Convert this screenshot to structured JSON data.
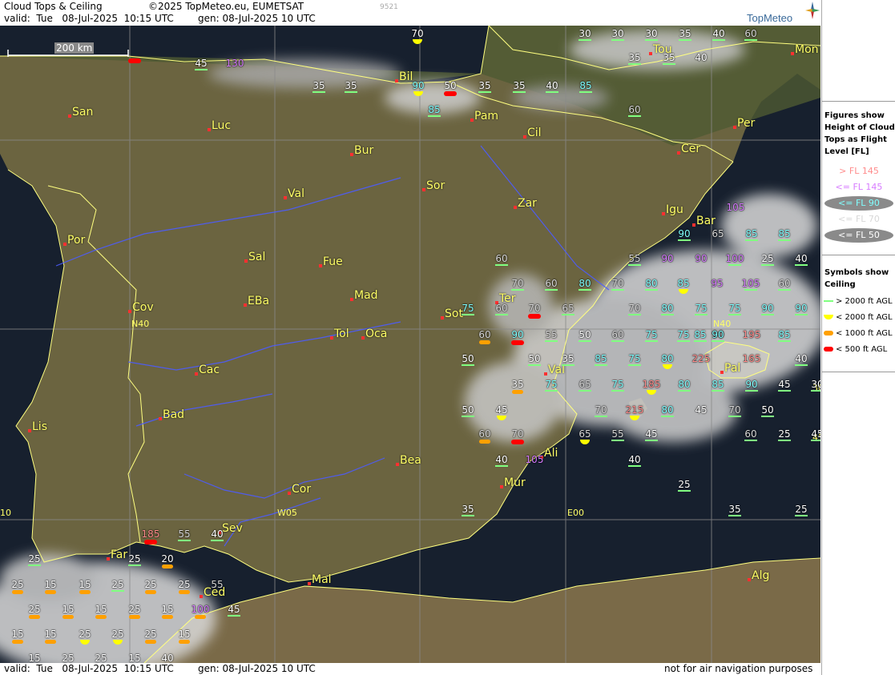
{
  "header": {
    "title": "Cloud Tops & Ceiling",
    "copyright": "©2025 TopMeteo.eu, EUMETSAT",
    "code": "9521",
    "valid": "valid:  Tue   08-Jul-2025  10:15 UTC",
    "gen": "gen: 08-Jul-2025 10 UTC",
    "logo": "TopMeteo"
  },
  "footer": {
    "valid": "valid:  Tue   08-Jul-2025  10:15 UTC",
    "gen": "gen: 08-Jul-2025 10 UTC",
    "disclaimer": "not for air navigation purposes"
  },
  "scale_label": "200 km",
  "legend": {
    "figures_title": "Figures show Height of Cloud Tops as Flight Level  [FL]",
    "figures": [
      {
        "label": "> FL 145",
        "color": "#ff8c8c",
        "pill": false
      },
      {
        "label": "<= FL 145",
        "color": "#d77cff",
        "pill": false
      },
      {
        "label": "<= FL 90",
        "color": "#80ffff",
        "pill": true
      },
      {
        "label": "<= FL 70",
        "color": "#d8d8d8",
        "pill": false
      },
      {
        "label": "<= FL 50",
        "color": "#ffffff",
        "pill": true
      }
    ],
    "symbols_title": "Symbols show Ceiling",
    "symbols": [
      {
        "label": "> 2000 ft AGL",
        "shape": "line",
        "color": "#80ff80"
      },
      {
        "label": "< 2000 ft AGL",
        "shape": "half",
        "color": "#ffff00"
      },
      {
        "label": "< 1000 ft AGL",
        "shape": "bar",
        "color": "#ffa000"
      },
      {
        "label": "< 500 ft AGL",
        "shape": "bar",
        "color": "#ff0000"
      }
    ]
  },
  "colors": {
    "land": "#6b6440",
    "sea": "#17202e",
    "border": "#ffff80",
    "river": "#4d5cff",
    "grid": "#8a8a8a",
    "city": "#ffff66",
    "cloud": "#d9d9d9"
  },
  "gridlabels": [
    "N40",
    "N40",
    "W05",
    "E00",
    "10",
    "30",
    "45"
  ],
  "cities": [
    {
      "name": "San"
    },
    {
      "name": "Luc"
    },
    {
      "name": "Bil"
    },
    {
      "name": "Pam"
    },
    {
      "name": "Tou"
    },
    {
      "name": "Mon"
    },
    {
      "name": "Per"
    },
    {
      "name": "Cer"
    },
    {
      "name": "Cil"
    },
    {
      "name": "Bur"
    },
    {
      "name": "Sor"
    },
    {
      "name": "Zar"
    },
    {
      "name": "Val"
    },
    {
      "name": "Igu"
    },
    {
      "name": "Bar"
    },
    {
      "name": "Por"
    },
    {
      "name": "Sal"
    },
    {
      "name": "Fue"
    },
    {
      "name": "Mad"
    },
    {
      "name": "Ter"
    },
    {
      "name": "EBa"
    },
    {
      "name": "Cov"
    },
    {
      "name": "Sot"
    },
    {
      "name": "Tol"
    },
    {
      "name": "Oca"
    },
    {
      "name": "Pal"
    },
    {
      "name": "Cac"
    },
    {
      "name": "Val"
    },
    {
      "name": "Bad"
    },
    {
      "name": "Lis"
    },
    {
      "name": "Ali"
    },
    {
      "name": "Bea"
    },
    {
      "name": "Mur"
    },
    {
      "name": "Cor"
    },
    {
      "name": "Sev"
    },
    {
      "name": "Far"
    },
    {
      "name": "Mal"
    },
    {
      "name": "Ced"
    },
    {
      "name": "Alg"
    }
  ],
  "markers": [
    {
      "v": "70",
      "c": "w",
      "s": "half"
    },
    {
      "v": "30",
      "c": "w",
      "s": "line"
    },
    {
      "v": "30",
      "c": "w",
      "s": "line"
    },
    {
      "v": "30",
      "c": "w",
      "s": "line"
    },
    {
      "v": "35",
      "c": "w",
      "s": "line"
    },
    {
      "v": "40",
      "c": "w",
      "s": "line"
    },
    {
      "v": "60",
      "c": "g",
      "s": "line"
    },
    {
      "v": "",
      "c": "w",
      "s": "red"
    },
    {
      "v": "45",
      "c": "w",
      "s": "line"
    },
    {
      "v": "130",
      "c": "m",
      "s": "none"
    },
    {
      "v": "35",
      "c": "w",
      "s": "line"
    },
    {
      "v": "35",
      "c": "w",
      "s": "line"
    },
    {
      "v": "40",
      "c": "w",
      "s": "none"
    },
    {
      "v": "35",
      "c": "w",
      "s": "line"
    },
    {
      "v": "35",
      "c": "w",
      "s": "line"
    },
    {
      "v": "35",
      "c": "w",
      "s": "line"
    },
    {
      "v": "40",
      "c": "w",
      "s": "line"
    },
    {
      "v": "85",
      "c": "c",
      "s": "line"
    },
    {
      "v": "90",
      "c": "c",
      "s": "half"
    },
    {
      "v": "50",
      "c": "w",
      "s": "red"
    },
    {
      "v": "35",
      "c": "w",
      "s": "line"
    },
    {
      "v": "85",
      "c": "c",
      "s": "line"
    },
    {
      "v": "60",
      "c": "g",
      "s": "line"
    },
    {
      "v": "90",
      "c": "c",
      "s": "line"
    },
    {
      "v": "65",
      "c": "g",
      "s": "none"
    },
    {
      "v": "85",
      "c": "c",
      "s": "line"
    },
    {
      "v": "85",
      "c": "c",
      "s": "line"
    },
    {
      "v": "105",
      "c": "m",
      "s": "none"
    },
    {
      "v": "60",
      "c": "g",
      "s": "line"
    },
    {
      "v": "55",
      "c": "g",
      "s": "line"
    },
    {
      "v": "90",
      "c": "m",
      "s": "none"
    },
    {
      "v": "90",
      "c": "m",
      "s": "none"
    },
    {
      "v": "100",
      "c": "m",
      "s": "line"
    },
    {
      "v": "25",
      "c": "w",
      "s": "line"
    },
    {
      "v": "40",
      "c": "w",
      "s": "line"
    },
    {
      "v": "70",
      "c": "g",
      "s": "line"
    },
    {
      "v": "60",
      "c": "g",
      "s": "line"
    },
    {
      "v": "80",
      "c": "c",
      "s": "line"
    },
    {
      "v": "70",
      "c": "g",
      "s": "line"
    },
    {
      "v": "80",
      "c": "c",
      "s": "line"
    },
    {
      "v": "85",
      "c": "c",
      "s": "half"
    },
    {
      "v": "95",
      "c": "m",
      "s": "none"
    },
    {
      "v": "105",
      "c": "m",
      "s": "line"
    },
    {
      "v": "60",
      "c": "g",
      "s": "line"
    },
    {
      "v": "75",
      "c": "c",
      "s": "line"
    },
    {
      "v": "60",
      "c": "g",
      "s": "line"
    },
    {
      "v": "70",
      "c": "g",
      "s": "red"
    },
    {
      "v": "65",
      "c": "g",
      "s": "line"
    },
    {
      "v": "70",
      "c": "g",
      "s": "line"
    },
    {
      "v": "80",
      "c": "c",
      "s": "line"
    },
    {
      "v": "75",
      "c": "c",
      "s": "line"
    },
    {
      "v": "75",
      "c": "c",
      "s": "line"
    },
    {
      "v": "90",
      "c": "c",
      "s": "line"
    },
    {
      "v": "90",
      "c": "c",
      "s": "line"
    },
    {
      "v": "60",
      "c": "g",
      "s": "orange"
    },
    {
      "v": "90",
      "c": "c",
      "s": "red"
    },
    {
      "v": "55",
      "c": "g",
      "s": "line"
    },
    {
      "v": "50",
      "c": "w",
      "s": "line"
    },
    {
      "v": "60",
      "c": "g",
      "s": "line"
    },
    {
      "v": "75",
      "c": "c",
      "s": "line"
    },
    {
      "v": "75",
      "c": "c",
      "s": "line"
    },
    {
      "v": "90",
      "c": "c",
      "s": "line"
    },
    {
      "v": "195",
      "c": "r",
      "s": "none"
    },
    {
      "v": "85",
      "c": "c",
      "s": "line"
    },
    {
      "v": "50",
      "c": "w",
      "s": "line"
    },
    {
      "v": "50",
      "c": "w",
      "s": "line"
    },
    {
      "v": "35",
      "c": "w",
      "s": "line"
    },
    {
      "v": "85",
      "c": "c",
      "s": "line"
    },
    {
      "v": "75",
      "c": "c",
      "s": "line"
    },
    {
      "v": "80",
      "c": "c",
      "s": "half"
    },
    {
      "v": "225",
      "c": "r",
      "s": "none"
    },
    {
      "v": "165",
      "c": "r",
      "s": "none"
    },
    {
      "v": "40",
      "c": "w",
      "s": "line"
    },
    {
      "v": "35",
      "c": "w",
      "s": "orange"
    },
    {
      "v": "75",
      "c": "c",
      "s": "line"
    },
    {
      "v": "65",
      "c": "g",
      "s": "line"
    },
    {
      "v": "75",
      "c": "c",
      "s": "line"
    },
    {
      "v": "185",
      "c": "r",
      "s": "half"
    },
    {
      "v": "80",
      "c": "c",
      "s": "line"
    },
    {
      "v": "85",
      "c": "c",
      "s": "line"
    },
    {
      "v": "90",
      "c": "c",
      "s": "line"
    },
    {
      "v": "45",
      "c": "w",
      "s": "line"
    },
    {
      "v": "30",
      "c": "w",
      "s": "line"
    },
    {
      "v": "50",
      "c": "w",
      "s": "line"
    },
    {
      "v": "45",
      "c": "w",
      "s": "half"
    },
    {
      "v": "70",
      "c": "g",
      "s": "line"
    },
    {
      "v": "215",
      "c": "r",
      "s": "half"
    },
    {
      "v": "80",
      "c": "c",
      "s": "line"
    },
    {
      "v": "45",
      "c": "w",
      "s": "none"
    },
    {
      "v": "70",
      "c": "g",
      "s": "line"
    },
    {
      "v": "50",
      "c": "w",
      "s": "line"
    },
    {
      "v": "60",
      "c": "g",
      "s": "orange"
    },
    {
      "v": "70",
      "c": "g",
      "s": "red"
    },
    {
      "v": "65",
      "c": "g",
      "s": "half"
    },
    {
      "v": "55",
      "c": "g",
      "s": "line"
    },
    {
      "v": "45",
      "c": "w",
      "s": "line"
    },
    {
      "v": "60",
      "c": "g",
      "s": "line"
    },
    {
      "v": "25",
      "c": "w",
      "s": "line"
    },
    {
      "v": "45",
      "c": "w",
      "s": "line"
    },
    {
      "v": "40",
      "c": "w",
      "s": "line"
    },
    {
      "v": "105",
      "c": "m",
      "s": "none"
    },
    {
      "v": "40",
      "c": "w",
      "s": "line"
    },
    {
      "v": "25",
      "c": "w",
      "s": "line"
    },
    {
      "v": "35",
      "c": "w",
      "s": "line"
    },
    {
      "v": "25",
      "c": "w",
      "s": "line"
    },
    {
      "v": "35",
      "c": "w",
      "s": "line"
    },
    {
      "v": "185",
      "c": "r",
      "s": "red"
    },
    {
      "v": "55",
      "c": "g",
      "s": "line"
    },
    {
      "v": "40",
      "c": "w",
      "s": "line"
    },
    {
      "v": "25",
      "c": "w",
      "s": "line"
    },
    {
      "v": "25",
      "c": "w",
      "s": "line"
    },
    {
      "v": "20",
      "c": "w",
      "s": "orange"
    },
    {
      "v": "25",
      "c": "w",
      "s": "orange"
    },
    {
      "v": "15",
      "c": "w",
      "s": "orange"
    },
    {
      "v": "15",
      "c": "w",
      "s": "orange"
    },
    {
      "v": "25",
      "c": "w",
      "s": "line"
    },
    {
      "v": "25",
      "c": "w",
      "s": "orange"
    },
    {
      "v": "25",
      "c": "w",
      "s": "orange"
    },
    {
      "v": "55",
      "c": "g",
      "s": "none"
    },
    {
      "v": "25",
      "c": "w",
      "s": "orange"
    },
    {
      "v": "15",
      "c": "w",
      "s": "orange"
    },
    {
      "v": "15",
      "c": "w",
      "s": "orange"
    },
    {
      "v": "25",
      "c": "w",
      "s": "orange"
    },
    {
      "v": "15",
      "c": "w",
      "s": "orange"
    },
    {
      "v": "100",
      "c": "m",
      "s": "orange"
    },
    {
      "v": "45",
      "c": "w",
      "s": "line"
    },
    {
      "v": "15",
      "c": "w",
      "s": "orange"
    },
    {
      "v": "15",
      "c": "w",
      "s": "orange"
    },
    {
      "v": "25",
      "c": "w",
      "s": "half"
    },
    {
      "v": "25",
      "c": "w",
      "s": "half"
    },
    {
      "v": "25",
      "c": "w",
      "s": "orange"
    },
    {
      "v": "15",
      "c": "w",
      "s": "orange"
    },
    {
      "v": "15",
      "c": "w",
      "s": "none"
    },
    {
      "v": "25",
      "c": "w",
      "s": "none"
    },
    {
      "v": "25",
      "c": "w",
      "s": "none"
    },
    {
      "v": "15",
      "c": "w",
      "s": "none"
    },
    {
      "v": "40",
      "c": "w",
      "s": "line"
    },
    {
      "v": "90",
      "c": "c",
      "s": "line"
    },
    {
      "v": "85",
      "c": "c",
      "s": "line"
    }
  ]
}
